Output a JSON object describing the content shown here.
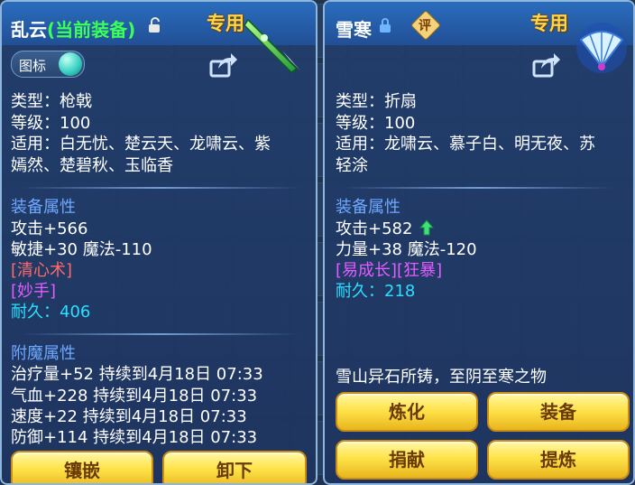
{
  "left_panel": {
    "title_main": "乱云",
    "title_status": "(当前装备)",
    "exclusive_label": "专用",
    "badge_label": "图标",
    "attrs": [
      {
        "label": "类型：",
        "value": "枪戟"
      },
      {
        "label": "等级：",
        "value": "100"
      },
      {
        "label": "适用：",
        "value": "白无忧、楚云天、龙啸云、紫"
      },
      {
        "label": "",
        "value": "嫣然、楚碧秋、玉临香"
      }
    ],
    "equip_attr_header": "装备属性",
    "stats": [
      "攻击+566",
      "敏捷+30 魔法-110"
    ],
    "skills": [
      "[清心术]",
      "[妙手]"
    ],
    "durability_label": "耐久：",
    "durability_value": "406",
    "enchant_header": "附魔属性",
    "enchants": [
      "治疗量+52 持续到4月18日 07:33",
      "气血+228 持续到4月18日 07:33",
      "速度+22 持续到4月18日 07:33",
      "防御+114 持续到4月18日 07:33"
    ],
    "buttons": [
      "镶嵌",
      "卸下"
    ]
  },
  "right_panel": {
    "title_main": "雪寒",
    "eval_label": "评",
    "exclusive_label": "专用",
    "attrs": [
      {
        "label": "类型：",
        "value": "折扇"
      },
      {
        "label": "等级：",
        "value": "100"
      },
      {
        "label": "适用：",
        "value": "龙啸云、慕子白、明无夜、苏"
      },
      {
        "label": "",
        "value": "轻涂"
      }
    ],
    "equip_attr_header": "装备属性",
    "stats": [
      "攻击+582",
      "力量+38 魔法-120"
    ],
    "skills": "[易成长][狂暴]",
    "durability_label": "耐久：",
    "durability_value": "218",
    "description": "雪山异石所铸，至阴至寒之物",
    "buttons": [
      "炼化",
      "装备",
      "捐献",
      "提炼"
    ]
  },
  "colors": {
    "panel_bg": "#223e6c",
    "highlight_green": "#3cff58",
    "label_blue": "#6ea8ff",
    "value_cyan": "#2be0ff",
    "skill_red": "#ff6a6a",
    "skill_magenta": "#e35cff",
    "exclusive_gold": "#ffd54a",
    "button_gold": "#ffe34a"
  },
  "icons": [
    "unlock-icon",
    "lock-icon",
    "share-icon",
    "spear-item-icon",
    "fan-item-icon",
    "gem-icon",
    "arrow-up-icon",
    "evaluate-icon"
  ]
}
